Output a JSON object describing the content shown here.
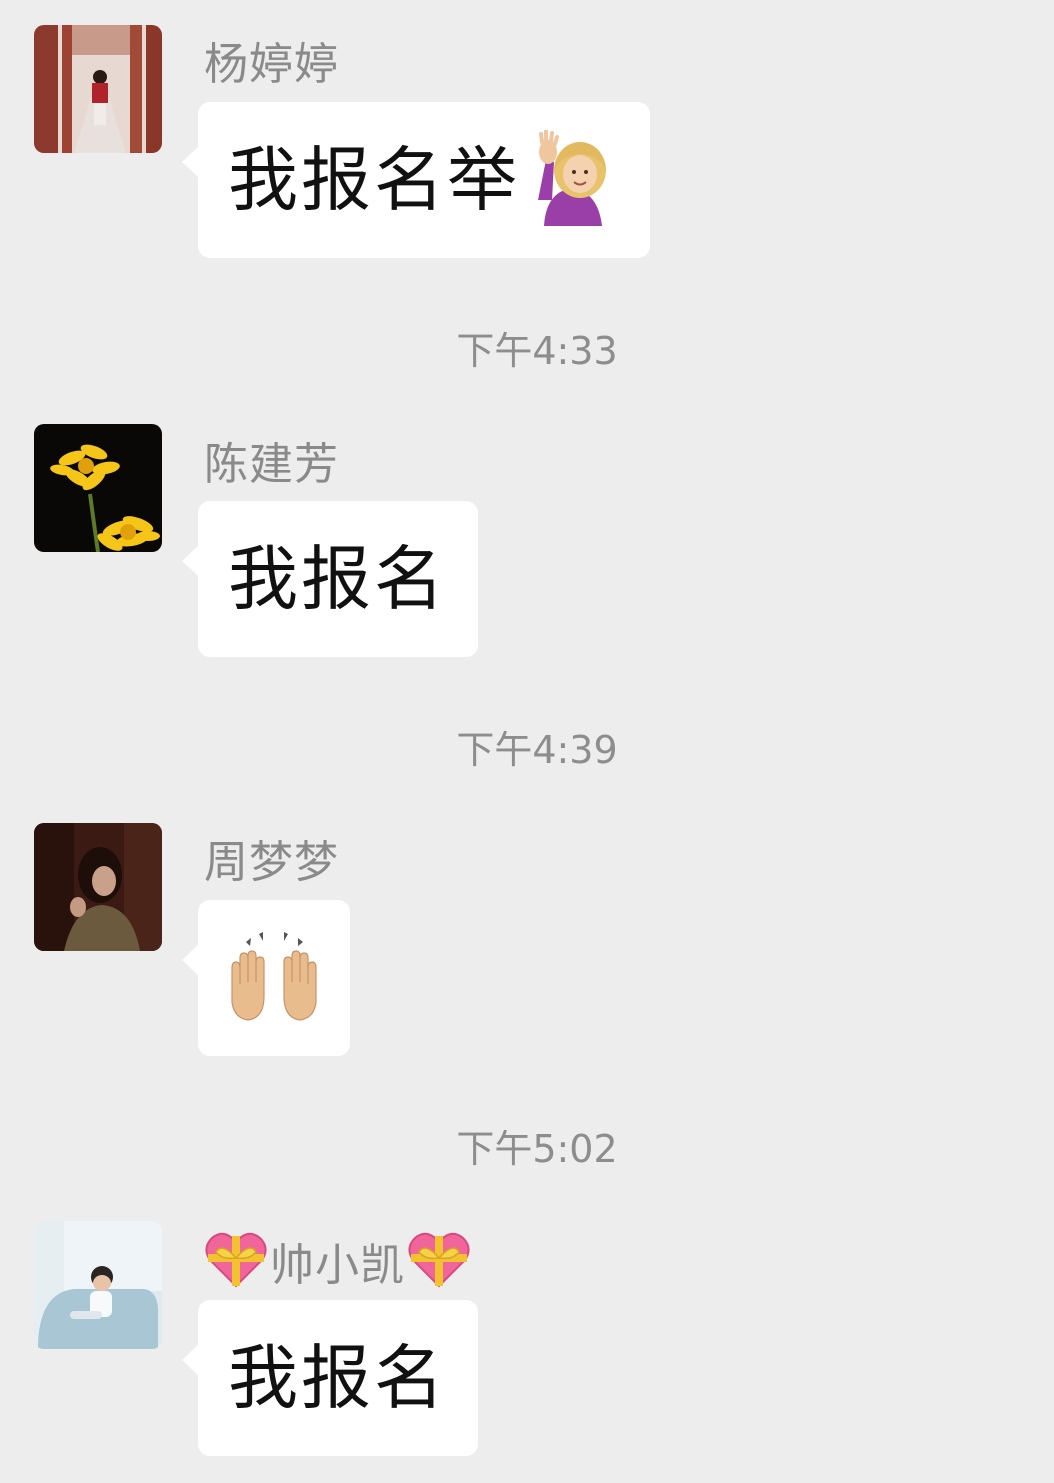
{
  "messages": [
    {
      "sender": "杨婷婷",
      "text": "我报名举",
      "emoji": "person-raising-hand-emoji",
      "avatar": "corridor-photo-avatar"
    },
    {
      "timestamp": "下午4:33"
    },
    {
      "sender": "陈建芳",
      "text": "我报名",
      "avatar": "yellow-flower-avatar"
    },
    {
      "timestamp": "下午4:39"
    },
    {
      "sender": "周梦梦",
      "text": "",
      "emoji": "raising-hands-emoji",
      "avatar": "woman-dark-photo-avatar"
    },
    {
      "timestamp": "下午5:02"
    },
    {
      "sender": "帅小凯",
      "sender_decoration": "heart-with-ribbon-emoji",
      "text": "我报名",
      "avatar": "child-on-sofa-avatar"
    }
  ],
  "colors": {
    "background": "#ededed",
    "bubble": "#ffffff",
    "sender_text": "#8a8a8a",
    "timestamp_text": "#8d8d8d",
    "message_text": "#111111"
  }
}
